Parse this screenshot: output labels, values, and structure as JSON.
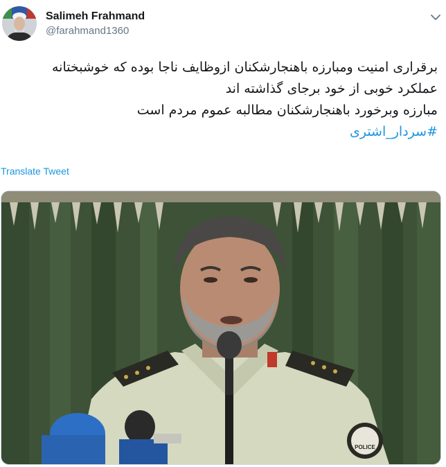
{
  "author": {
    "display_name": "Salimeh Frahmand",
    "handle": "@farahmand1360",
    "avatar_icon": "profile-portrait-icon"
  },
  "menu": {
    "caret_icon": "chevron-down-icon"
  },
  "tweet": {
    "lines": [
      "برقراری امنیت ومبارزه باهنجارشکنان ازوظایف ناجا بوده که خوشبختانه",
      "عملکرد خوبی از خود برجای گذاشته اند",
      "مبارزه وبرخورد باهنجارشکنان مطالبه عموم مردم است"
    ],
    "hashtag": "#سردار_اشتری",
    "translate_label": "Translate Tweet"
  },
  "media": {
    "badge_text": "POLICE"
  },
  "colors": {
    "link": "#1b95e0",
    "text": "#14171a",
    "secondary": "#657786",
    "curtain": "#3f5538"
  }
}
